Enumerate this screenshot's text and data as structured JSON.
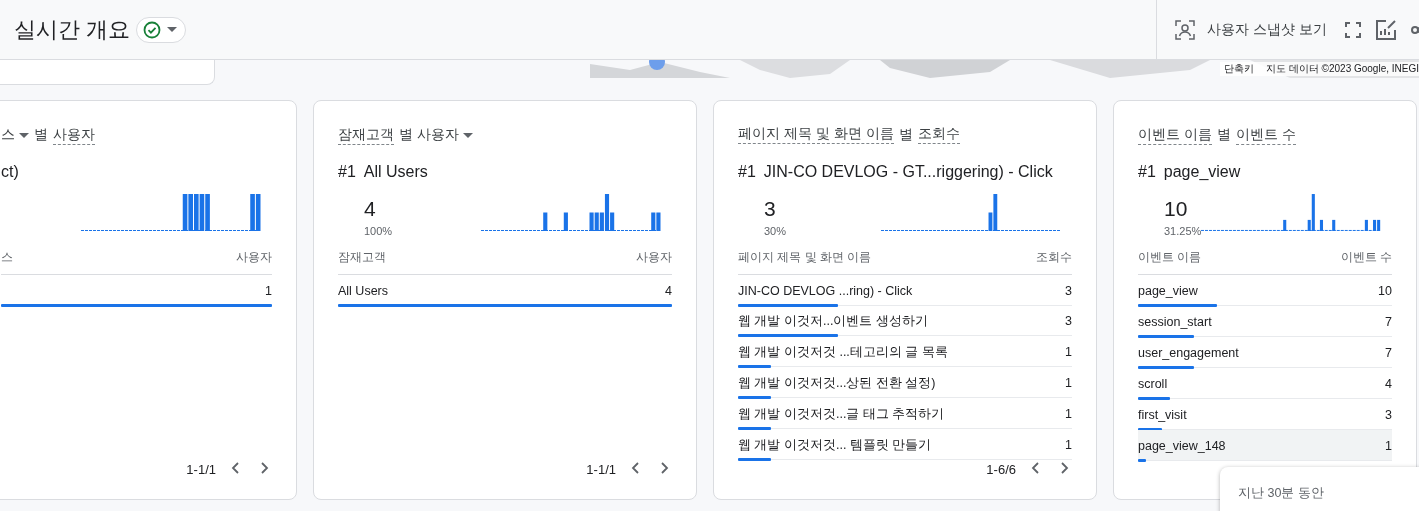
{
  "header": {
    "title": "실시간 개요",
    "status": {
      "ok": true
    },
    "snapshot_button": "사용자 스냅샷 보기"
  },
  "map": {
    "shortcuts": "단축키",
    "attribution": "지도 데이터 ©2023 Google, INEGI"
  },
  "cards": [
    {
      "title_parts": [
        {
          "text": "스",
          "underlined": false,
          "dropdown": true
        },
        {
          "text": "별",
          "underlined": false,
          "dropdown": false
        },
        {
          "text": "사용자",
          "underlined": true,
          "dropdown": false
        }
      ],
      "top": {
        "name": "ct)"
      },
      "columns": [
        "스",
        "사용자"
      ],
      "rows": [
        {
          "value": "1",
          "level": 1,
          "highlighted": false
        }
      ],
      "pagination": "1-1/1"
    },
    {
      "title_parts": [
        {
          "text": "잠재고객",
          "underlined": true,
          "dropdown": false
        },
        {
          "text": "별 사용자",
          "underlined": false,
          "dropdown": true
        }
      ],
      "top": {
        "rank": "#1",
        "name": "All Users",
        "value": "4",
        "percent": "100%"
      },
      "columns": [
        "잠재고객",
        "사용자"
      ],
      "rows": [
        {
          "label": "All Users",
          "value": "4",
          "level": 1,
          "highlighted": false
        }
      ],
      "pagination": "1-1/1"
    },
    {
      "title_parts": [
        {
          "text": "페이지 제목 및 화면 이름",
          "underlined": true,
          "dropdown": false
        },
        {
          "text": "별",
          "underlined": false,
          "dropdown": false
        },
        {
          "text": "조회수",
          "underlined": true,
          "dropdown": false
        }
      ],
      "top": {
        "rank": "#1",
        "name": "JIN-CO DEVLOG - GT...riggering) - Click",
        "value": "3",
        "percent": "30%"
      },
      "columns": [
        "페이지 제목 및 화면 이름",
        "조회수"
      ],
      "rows": [
        {
          "label": "JIN-CO DEVLOG ...ring) - Click",
          "value": "3",
          "level": 0.3,
          "highlighted": false
        },
        {
          "label": "웹 개발 이것저...이벤트 생성하기",
          "value": "3",
          "level": 0.3,
          "highlighted": false
        },
        {
          "label": "웹 개발 이것저것 ...테고리의 글 목록",
          "value": "1",
          "level": 0.1,
          "highlighted": false
        },
        {
          "label": "웹 개발 이것저것...상된 전환 설정)",
          "value": "1",
          "level": 0.1,
          "highlighted": false
        },
        {
          "label": "웹 개발 이것저것...글 태그 추적하기",
          "value": "1",
          "level": 0.1,
          "highlighted": false
        },
        {
          "label": "웹 개발 이것저것... 템플릿 만들기",
          "value": "1",
          "level": 0.1,
          "highlighted": false
        }
      ],
      "pagination": "1-6/6"
    },
    {
      "title_parts": [
        {
          "text": "이벤트 이름",
          "underlined": true,
          "dropdown": false
        },
        {
          "text": "별",
          "underlined": false,
          "dropdown": false
        },
        {
          "text": "이벤트 수",
          "underlined": true,
          "dropdown": false
        }
      ],
      "top": {
        "rank": "#1",
        "name": "page_view",
        "value": "10",
        "percent": "31.25%"
      },
      "columns": [
        "이벤트 이름",
        "이벤트 수"
      ],
      "rows": [
        {
          "label": "page_view",
          "value": "10",
          "level": 0.3125,
          "highlighted": false
        },
        {
          "label": "session_start",
          "value": "7",
          "level": 0.22,
          "highlighted": false
        },
        {
          "label": "user_engagement",
          "value": "7",
          "level": 0.22,
          "highlighted": false
        },
        {
          "label": "scroll",
          "value": "4",
          "level": 0.125,
          "highlighted": false
        },
        {
          "label": "first_visit",
          "value": "3",
          "level": 0.094,
          "highlighted": false
        },
        {
          "label": "page_view_148",
          "value": "1",
          "level": 0.031,
          "highlighted": true
        }
      ]
    }
  ],
  "tooltip": {
    "text": "지난 30분 동안"
  }
}
